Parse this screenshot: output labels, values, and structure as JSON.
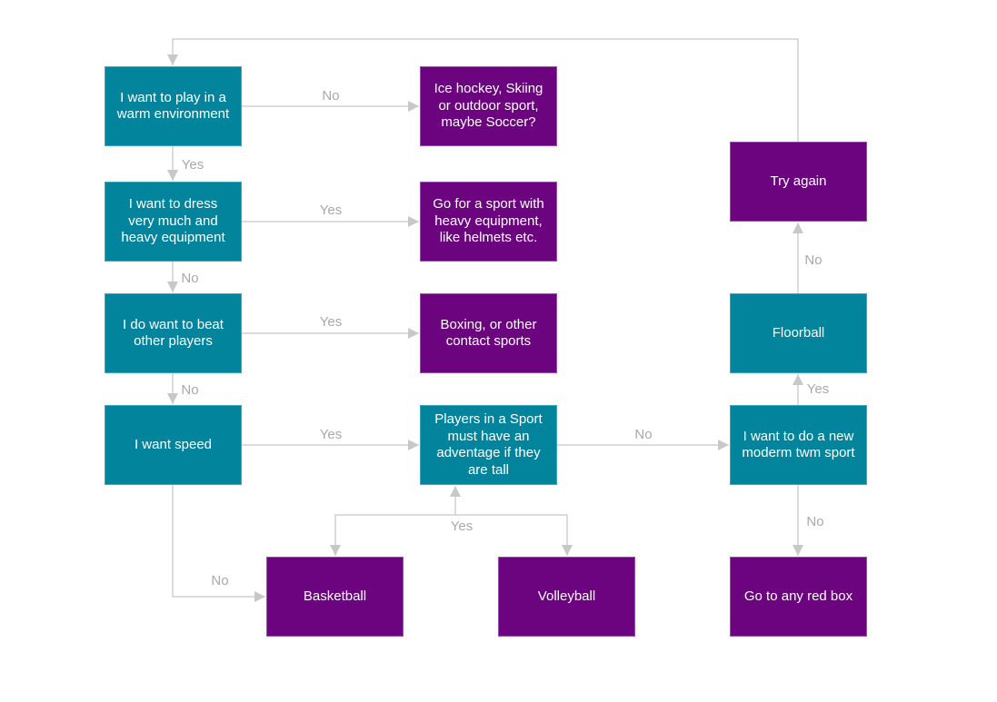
{
  "colors": {
    "decision": "#02849d",
    "outcome": "#6d047f",
    "connector": "#c8c8c8",
    "label": "#a9a9a9"
  },
  "nodes": {
    "warm": {
      "text": "I want to play in a\nwarm environment",
      "kind": "decision"
    },
    "ice": {
      "text": "Ice hockey, Skiing\nor outdoor sport,\nmaybe Soccer?",
      "kind": "outcome"
    },
    "dress": {
      "text": "I want to dress\nvery much and\nheavy equipment",
      "kind": "decision"
    },
    "heavy": {
      "text": "Go for a sport with\nheavy equipment,\nlike helmets etc.",
      "kind": "outcome"
    },
    "beat": {
      "text": "I do want to beat\nother players",
      "kind": "decision"
    },
    "boxing": {
      "text": "Boxing, or other\ncontact sports",
      "kind": "outcome"
    },
    "speed": {
      "text": "I want speed",
      "kind": "decision"
    },
    "tall": {
      "text": "Players in a  Sport\nmust have an\nadventage if they\nare tall",
      "kind": "decision"
    },
    "basketball": {
      "text": "Basketball",
      "kind": "outcome"
    },
    "volleyball": {
      "text": "Volleyball",
      "kind": "outcome"
    },
    "modern": {
      "text": "I want to do a new\nmoderm twm sport",
      "kind": "decision"
    },
    "floorball": {
      "text": "Floorball",
      "kind": "decision"
    },
    "tryagain": {
      "text": "Try again",
      "kind": "outcome"
    },
    "redbox": {
      "text": "Go to any red box",
      "kind": "outcome"
    }
  },
  "edges": [
    {
      "from": "warm",
      "to": "ice",
      "label": "No"
    },
    {
      "from": "warm",
      "to": "dress",
      "label": "Yes"
    },
    {
      "from": "dress",
      "to": "heavy",
      "label": "Yes"
    },
    {
      "from": "dress",
      "to": "beat",
      "label": "No"
    },
    {
      "from": "beat",
      "to": "boxing",
      "label": "Yes"
    },
    {
      "from": "beat",
      "to": "speed",
      "label": "No"
    },
    {
      "from": "speed",
      "to": "tall",
      "label": "Yes"
    },
    {
      "from": "speed",
      "to": "basketball",
      "label": "No"
    },
    {
      "from": "tall",
      "to": "modern",
      "label": "No"
    },
    {
      "from": "basketball",
      "to": "tall",
      "label": "Yes"
    },
    {
      "from": "volleyball",
      "to": "tall",
      "label": "Yes"
    },
    {
      "from": "modern",
      "to": "floorball",
      "label": "Yes"
    },
    {
      "from": "modern",
      "to": "redbox",
      "label": "No"
    },
    {
      "from": "floorball",
      "to": "tryagain",
      "label": "No"
    },
    {
      "from": "tryagain",
      "to": "warm",
      "label": ""
    }
  ]
}
